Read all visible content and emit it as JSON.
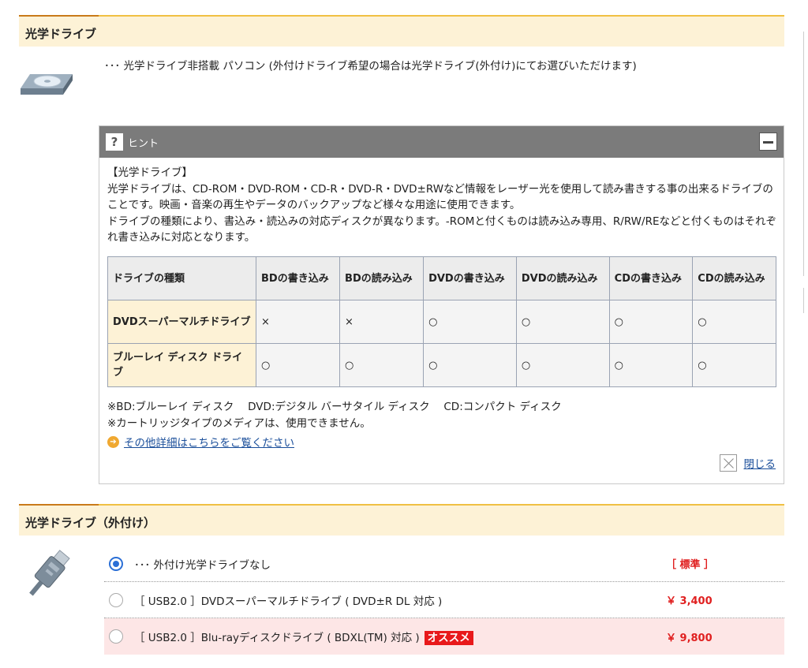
{
  "section1": {
    "title": "光学ドライブ",
    "description": "･･･ 光学ドライブ非搭載 パソコン (外付けドライブ希望の場合は光学ドライブ(外付け)にてお選びいただけます)"
  },
  "hint": {
    "icon_char": "?",
    "title": "ヒント",
    "heading": "【光学ドライブ】",
    "paragraph1": "光学ドライブは、CD-ROM・DVD-ROM・CD-R・DVD-R・DVD±RWなど情報をレーザー光を使用して読み書きする事の出来るドライブのことです。映画・音楽の再生やデータのバックアップなど様々な用途に使用できます。",
    "paragraph2": "ドライブの種類により、書込み・読込みの対応ディスクが異なります。-ROMと付くものは読み込み専用、R/RW/REなどと付くものはそれぞれ書き込みに対応となります。",
    "table": {
      "headers": [
        "ドライブの種類",
        "BDの書き込み",
        "BDの読み込み",
        "DVDの書き込み",
        "DVDの読み込み",
        "CDの書き込み",
        "CDの読み込み"
      ],
      "rows": [
        [
          "DVDスーパーマルチドライブ",
          "×",
          "×",
          "○",
          "○",
          "○",
          "○"
        ],
        [
          "ブルーレイ ディスク ドライブ",
          "○",
          "○",
          "○",
          "○",
          "○",
          "○"
        ]
      ]
    },
    "note1": "※BD:ブルーレイ ディスク　 DVD:デジタル バーサタイル ディスク　 CD:コンパクト ディスク",
    "note2": "※カートリッジタイプのメディアは、使用できません。",
    "more_link": "その他詳細はこちらをご覧ください",
    "close_label": "閉じる"
  },
  "section2": {
    "title": "光学ドライブ（外付け）",
    "options": [
      {
        "label": "･･･ 外付け光学ドライブなし",
        "price": "［ 標準 ］",
        "selected": true,
        "badge": ""
      },
      {
        "label": "［ USB2.0 ］DVDスーパーマルチドライブ ( DVD±R DL 対応 )",
        "price": "￥ 3,400",
        "selected": false,
        "badge": ""
      },
      {
        "label": "［ USB2.0 ］Blu-rayディスクドライブ ( BDXL(TM) 対応 )",
        "price": "￥ 9,800",
        "selected": false,
        "badge": "オススメ"
      }
    ]
  },
  "colors": {
    "header_bg": "#fdf2d6",
    "header_border": "#f0c043",
    "price_red": "#e02020",
    "link_blue": "#1a4e9a",
    "radio_blue": "#2b6fd6",
    "recommend_bg": "#fde6e6"
  }
}
